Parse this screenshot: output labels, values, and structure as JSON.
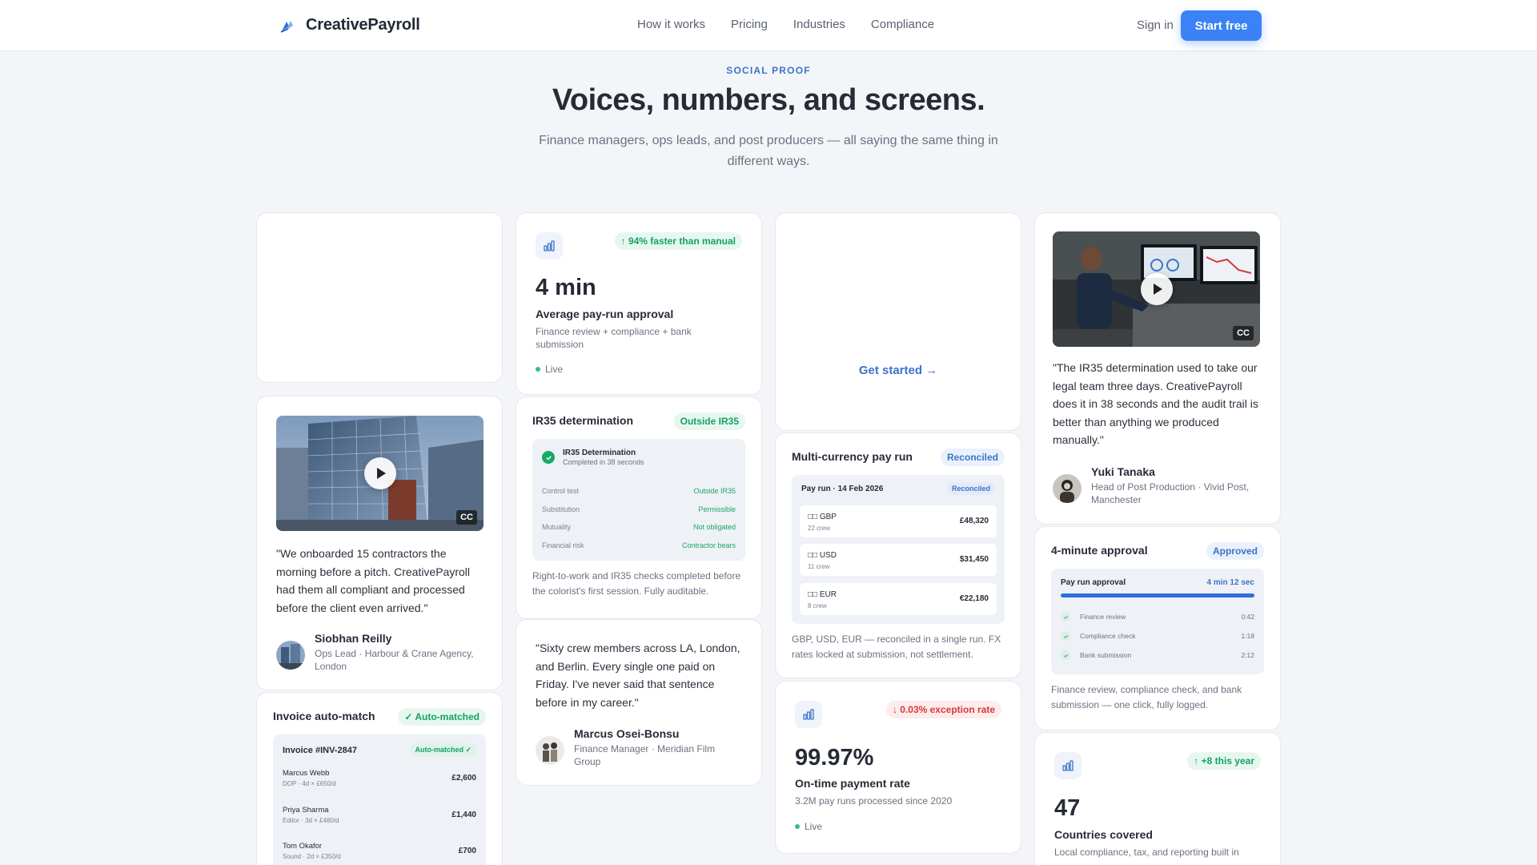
{
  "nav": {
    "brand": "CreativePayroll",
    "links": [
      "How it works",
      "Pricing",
      "Industries",
      "Compliance"
    ],
    "signin": "Sign in",
    "cta": "Start free"
  },
  "hero": {
    "eyebrow": "SOCIAL PROOF",
    "title": "Voices, numbers, and screens.",
    "subtitle": "Finance managers, ops leads, and post producers — all saying the same thing in different ways."
  },
  "colors": {
    "accent": "#3b82f6",
    "link": "#3b74c9",
    "success": "#14a365",
    "danger": "#d93838",
    "background": "#f3f5f8"
  },
  "testimonials": [
    {
      "quote": "\"We onboarded 15 contractors the morning before a pitch. CreativePayroll had them all compliant and processed before the client even arrived.\"",
      "name": "Siobhan Reilly",
      "role": "Ops Lead · Harbour & Crane Agency, London",
      "cc": "CC"
    },
    {
      "quote": "\"Sixty crew members across LA, London, and Berlin. Every single one paid on Friday. I've never said that sentence before in my career.\"",
      "name": "Marcus Osei-Bonsu",
      "role": "Finance Manager · Meridian Film Group"
    },
    {
      "quote": "\"The IR35 determination used to take our legal team three days. CreativePayroll does it in 38 seconds and the audit trail is better than anything we produced manually.\"",
      "name": "Yuki Tanaka",
      "role": "Head of Post Production · Vivid Post, Manchester",
      "cc": "CC"
    }
  ],
  "stats": [
    {
      "badge": "↑ 94% faster than manual",
      "value": "4 min",
      "label": "Average pay-run approval",
      "desc": "Finance review + compliance + bank submission",
      "status": "Live"
    },
    {
      "badge": "↓ 0.03% exception rate",
      "value": "99.97%",
      "label": "On-time payment rate",
      "desc": "3.2M pay runs processed since 2020",
      "status": "Live"
    },
    {
      "badge": "↑ +8 this year",
      "value": "47",
      "label": "Countries covered",
      "desc": "Local compliance, tax, and reporting built in"
    }
  ],
  "get_started": "Get started →",
  "ir35": {
    "title": "IR35 determination",
    "badge": "Outside IR35",
    "panel_title": "IR35 Determination",
    "panel_sub": "Completed in 38 seconds",
    "rows": [
      {
        "k": "Control test",
        "v": "Outside IR35"
      },
      {
        "k": "Substitution",
        "v": "Permissible"
      },
      {
        "k": "Mutuality",
        "v": "Not obligated"
      },
      {
        "k": "Financial risk",
        "v": "Contractor bears"
      }
    ],
    "desc": "Right-to-work and IR35 checks completed before the colorist's first session. Fully auditable."
  },
  "multicurrency": {
    "title": "Multi-currency pay run",
    "badge": "Reconciled",
    "panel_title": "Pay run · 14 Feb 2026",
    "panel_badge": "Reconciled",
    "rows": [
      {
        "code": "□□ GBP",
        "crew": "22 crew",
        "amount": "£48,320"
      },
      {
        "code": "□□ USD",
        "crew": "11 crew",
        "amount": "$31,450"
      },
      {
        "code": "□□ EUR",
        "crew": "8 crew",
        "amount": "€22,180"
      }
    ],
    "desc": "GBP, USD, EUR — reconciled in a single run. FX rates locked at submission, not settlement."
  },
  "approval": {
    "title": "4-minute approval",
    "badge": "Approved",
    "panel_title": "Pay run approval",
    "time": "4 min 12 sec",
    "progress": 1.0,
    "steps": [
      {
        "label": "Finance review",
        "t": "0:42"
      },
      {
        "label": "Compliance check",
        "t": "1:18"
      },
      {
        "label": "Bank submission",
        "t": "2:12"
      }
    ],
    "desc": "Finance review, compliance check, and bank submission — one click, fully logged."
  },
  "invoice": {
    "title": "Invoice auto-match",
    "badge": "✓ Auto-matched",
    "invoice_no": "Invoice #INV-2847",
    "invoice_badge": "Auto-matched ✓",
    "rows": [
      {
        "name": "Marcus Webb",
        "sub": "DOP · 4d × £650/d",
        "amount": "£2,600"
      },
      {
        "name": "Priya Sharma",
        "sub": "Editor · 3d × £480/d",
        "amount": "£1,440"
      },
      {
        "name": "Tom Okafor",
        "sub": "Sound · 2d × £350/d",
        "amount": "£700"
      }
    ]
  }
}
